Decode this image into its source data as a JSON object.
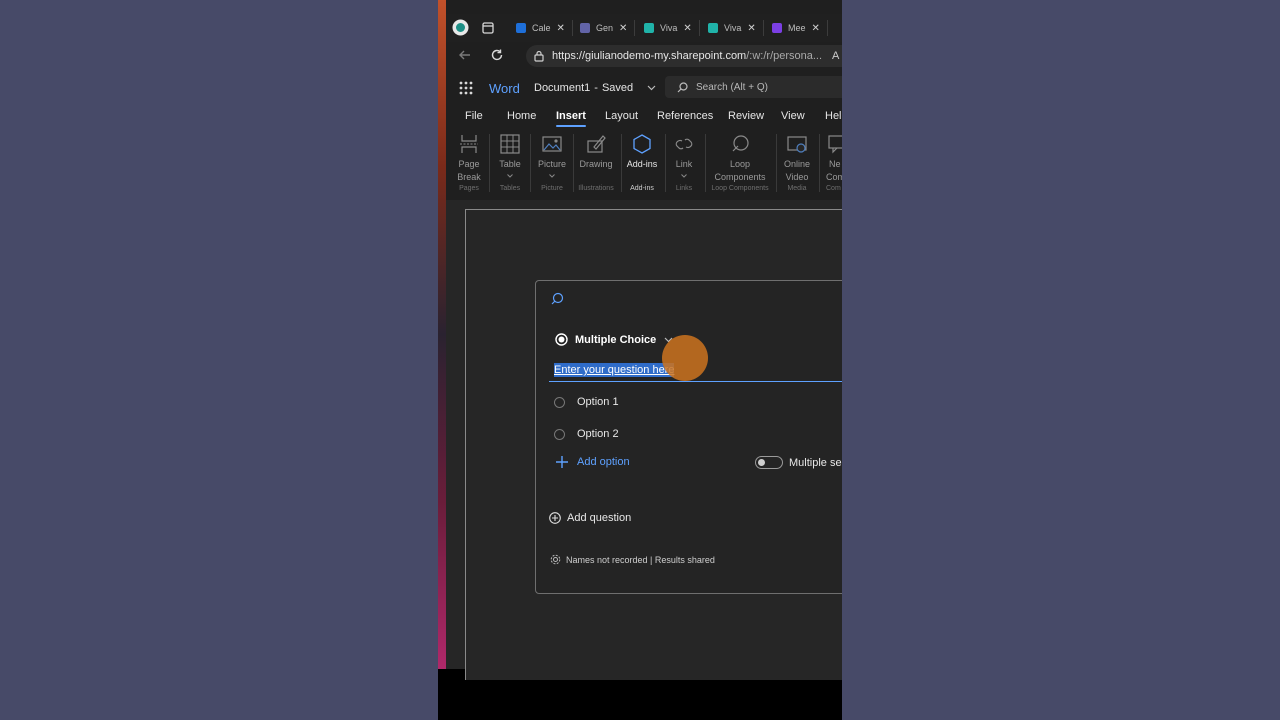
{
  "browser": {
    "tabs": [
      {
        "label": "Cale",
        "color": "#1e6fd9"
      },
      {
        "label": "Gen",
        "color": "#6264a7"
      },
      {
        "label": "Viva",
        "color": "#20b3a9"
      },
      {
        "label": "Viva",
        "color": "#20b3a9"
      },
      {
        "label": "Mee",
        "color": "#7b3fe4"
      }
    ],
    "url_host": "https://giulianodemo-my.sharepoint.com",
    "url_path": "/:w:/r/persona...",
    "read_aloud": "A"
  },
  "word": {
    "app_name": "Word",
    "doc_title": "Document1",
    "separator": "-",
    "save_status": "Saved",
    "search_placeholder": "Search (Alt + Q)"
  },
  "ribbon_tabs": [
    "File",
    "Home",
    "Insert",
    "Layout",
    "References",
    "Review",
    "View",
    "Help"
  ],
  "ribbon": {
    "page_break": {
      "line1": "Page",
      "line2": "Break",
      "group": "Pages"
    },
    "table": {
      "line1": "Table",
      "group": "Tables"
    },
    "picture": {
      "line1": "Picture",
      "group": "Picture"
    },
    "drawing": {
      "line1": "Drawing",
      "group": "Illustrations"
    },
    "addins": {
      "line1": "Add-ins",
      "group": "Add-ins"
    },
    "link": {
      "line1": "Link",
      "group": "Links"
    },
    "loop": {
      "line1": "Loop",
      "line2": "Components",
      "group": "Loop Components"
    },
    "video": {
      "line1": "Online",
      "line2": "Video",
      "group": "Media"
    },
    "comment": {
      "line1": "Ne",
      "line2": "Com",
      "group": "Com"
    }
  },
  "poll": {
    "type_label": "Multiple Choice",
    "question_placeholder": "Enter your question here",
    "options": [
      "Option 1",
      "Option 2"
    ],
    "add_option": "Add option",
    "multiple_select": "Multiple sel",
    "add_question": "Add question",
    "footer": "Names not recorded | Results shared"
  }
}
